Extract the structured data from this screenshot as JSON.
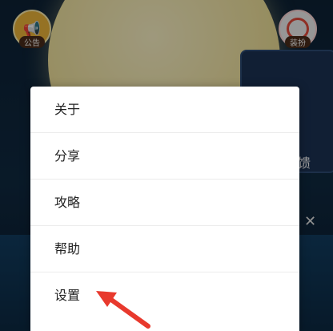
{
  "background": {
    "announce_label": "公告",
    "skin_label": "装扮",
    "side_fragment": "馈",
    "close_glyph": "✕"
  },
  "menu": {
    "items": [
      {
        "label": "关于"
      },
      {
        "label": "分享"
      },
      {
        "label": "攻略"
      },
      {
        "label": "帮助"
      },
      {
        "label": "设置"
      }
    ]
  },
  "colors": {
    "arrow": "#e8392d",
    "menu_bg": "#ffffff",
    "moon": "#f5e7a2",
    "night": "#0d2236"
  }
}
